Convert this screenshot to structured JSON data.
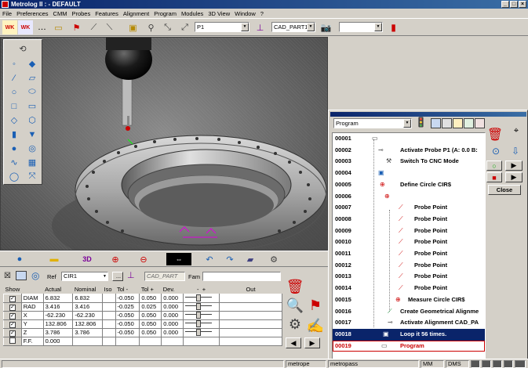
{
  "window": {
    "title": "Metrolog II : - DEFAULT",
    "buttons": [
      "_",
      "□",
      "×"
    ]
  },
  "menu": [
    "File",
    "Preferences",
    "CMM",
    "Probes",
    "Features",
    "Alignment",
    "Program",
    "Modules",
    "3D View",
    "Window",
    "?"
  ],
  "toolbar": {
    "probe_select": "P1",
    "part_select": "CAD_PART1",
    "extra_select": ""
  },
  "feature_panel": {
    "ref_label": "Ref",
    "ref_value": "CIR1",
    "more_button": "...",
    "cad_part": "CAD_PART",
    "fam_label": "Fam",
    "fam_value": "",
    "columns": [
      "Show",
      "Actual",
      "Nominal",
      "Iso",
      "Tol -",
      "Tol +",
      "Dev.",
      "-",
      "+",
      "Out"
    ],
    "rows": [
      {
        "name": "DIAM",
        "actual": "6.832",
        "nominal": "6.832",
        "iso": "",
        "tol_minus": "-0.050",
        "tol_plus": "0.050",
        "dev": "0.000"
      },
      {
        "name": "RAD",
        "actual": "3.416",
        "nominal": "3.416",
        "iso": "",
        "tol_minus": "-0.025",
        "tol_plus": "0.025",
        "dev": "0.000"
      },
      {
        "name": "X",
        "actual": "-62.230",
        "nominal": "-62.230",
        "iso": "",
        "tol_minus": "-0.050",
        "tol_plus": "0.050",
        "dev": "0.000"
      },
      {
        "name": "Y",
        "actual": "132.806",
        "nominal": "132.806",
        "iso": "",
        "tol_minus": "-0.050",
        "tol_plus": "0.050",
        "dev": "0.000"
      },
      {
        "name": "Z",
        "actual": "3.786",
        "nominal": "3.786",
        "iso": "",
        "tol_minus": "-0.050",
        "tol_plus": "0.050",
        "dev": "0.000"
      },
      {
        "name": "F.F.",
        "actual": "0.000",
        "nominal": "",
        "iso": "",
        "tol_minus": "",
        "tol_plus": "",
        "dev": ""
      }
    ]
  },
  "program_panel": {
    "combo": "Program",
    "close_label": "Close",
    "lines": [
      {
        "num": "00001",
        "text": ""
      },
      {
        "num": "00002",
        "text": "Activate Probe  P1 (A:  0.0 B:"
      },
      {
        "num": "00003",
        "text": "Switch To CNC Mode"
      },
      {
        "num": "00004",
        "text": ""
      },
      {
        "num": "00005",
        "text": "Define Circle CIR$"
      },
      {
        "num": "00006",
        "text": ""
      },
      {
        "num": "00007",
        "text": "Probe Point"
      },
      {
        "num": "00008",
        "text": "Probe Point"
      },
      {
        "num": "00009",
        "text": "Probe Point"
      },
      {
        "num": "00010",
        "text": "Probe Point"
      },
      {
        "num": "00011",
        "text": "Probe Point"
      },
      {
        "num": "00012",
        "text": "Probe Point"
      },
      {
        "num": "00013",
        "text": "Probe Point"
      },
      {
        "num": "00014",
        "text": "Probe Point"
      },
      {
        "num": "00015",
        "text": "Measure Circle CIR$"
      },
      {
        "num": "00016",
        "text": "Create Geometrical Alignme"
      },
      {
        "num": "00017",
        "text": "Activate Alignment CAD_PA"
      },
      {
        "num": "00018",
        "text": "Loop it 56 times."
      },
      {
        "num": "00019",
        "text": "Program"
      }
    ]
  },
  "statusbar": {
    "user": "metrope",
    "profile": "metropass",
    "unit": "MM",
    "angle": "DMS"
  },
  "colors": {
    "title": "#0a246a",
    "selection": "#0a246a",
    "error_row": "#c00000",
    "face": "#d4d0c8"
  }
}
